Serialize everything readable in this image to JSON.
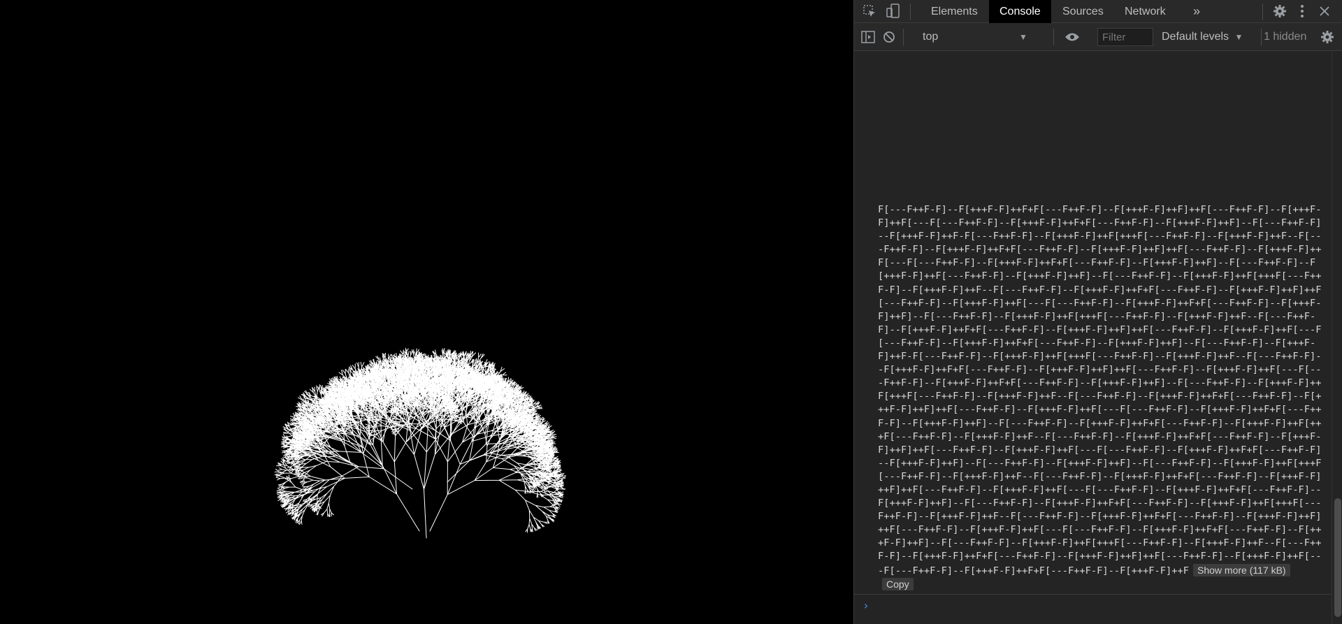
{
  "devtools": {
    "tabs": [
      {
        "label": "Elements",
        "active": false
      },
      {
        "label": "Console",
        "active": true
      },
      {
        "label": "Sources",
        "active": false
      },
      {
        "label": "Network",
        "active": false
      }
    ],
    "more_tabs_glyph": "»",
    "toolbar": {
      "context": "top",
      "filter_placeholder": "Filter",
      "levels": "Default levels",
      "hidden": "1 hidden"
    },
    "log": {
      "text": "F[---F++F-F]--F[+++F-F]++F+F[---F++F-F]--F[+++F-F]++F]++F[---F++F-F]--F[+++F-F]++F[---F[---F++F-F]--F[+++F-F]++F+F[---F++F-F]--F[+++F-F]++F]--F[---F++F-F]--F[+++F-F]++F-F[---F++F-F]--F[+++F-F]++F[+++F[---F++F-F]--F[+++F-F]++F--F[---F++F-F]--F[+++F-F]++F+F[---F++F-F]--F[+++F-F]++F]++F[---F++F-F]--F[+++F-F]++F[---F[---F++F-F]--F[+++F-F]++F+F[---F++F-F]--F[+++F-F]++F]--F[---F++F-F]--F[+++F-F]++F[---F++F-F]--F[+++F-F]++F]--F[---F++F-F]--F[+++F-F]++F[+++F[---F++F-F]--F[+++F-F]++F--F[---F++F-F]--F[+++F-F]++F+F[---F++F-F]--F[+++F-F]++F]++F[---F++F-F]--F[+++F-F]++F[---F[---F++F-F]--F[+++F-F]++F+F[---F++F-F]--F[+++F-F]++F]--F[---F++F-F]--F[+++F-F]++F[+++F[---F++F-F]--F[+++F-F]++F--F[---F++F-F]--F[+++F-F]++F+F[---F++F-F]--F[+++F-F]++F]++F[---F++F-F]--F[+++F-F]++F[---F[---F++F-F]--F[+++F-F]++F+F[---F++F-F]--F[+++F-F]++F]--F[---F++F-F]--F[+++F-F]++F-F[---F++F-F]--F[+++F-F]++F[+++F[---F++F-F]--F[+++F-F]++F--F[---F++F-F]--F[+++F-F]++F+F[---F++F-F]--F[+++F-F]++F]++F[---F++F-F]--F[+++F-F]++F[---F[---F++F-F]--F[+++F-F]++F+F[---F++F-F]--F[+++F-F]++F]--F[---F++F-F]--F[+++F-F]++F[+++F[---F++F-F]--F[+++F-F]++F--F[---F++F-F]--F[+++F-F]++F+F[---F++F-F]--F[+++F-F]++F]++F[---F++F-F]--F[+++F-F]++F[---F[---F++F-F]--F[+++F-F]++F+F[---F++F-F]--F[+++F-F]++F]--F[---F++F-F]--F[+++F-F]++F+F[---F++F-F]--F[+++F-F]++F[+++F[---F++F-F]--F[+++F-F]++F--F[---F++F-F]--F[+++F-F]++F+F[---F++F-F]--F[+++F-F]++F]++F[---F++F-F]--F[+++F-F]++F[---F[---F++F-F]--F[+++F-F]++F+F[---F++F-F]--F[+++F-F]++F]--F[---F++F-F]--F[+++F-F]++F]--F[---F++F-F]--F[+++F-F]++F[+++F[---F++F-F]--F[+++F-F]++F--F[---F++F-F]--F[+++F-F]++F+F[---F++F-F]--F[+++F-F]++F]++F[---F++F-F]--F[+++F-F]++F[---F[---F++F-F]--F[+++F-F]++F+F[---F++F-F]--F[+++F-F]++F]--F[---F++F-F]--F[+++F-F]++F+F[---F++F-F]--F[+++F-F]++F[+++F[---F++F-F]--F[+++F-F]++F--F[---F++F-F]--F[+++F-F]++F+F[---F++F-F]--F[+++F-F]++F]++F[---F++F-F]--F[+++F-F]++F[---F[---F++F-F]--F[+++F-F]++F+F[---F++F-F]--F[+++F-F]++F]--F[---F++F-F]--F[+++F-F]++F[+++F[---F++F-F]--F[+++F-F]++F--F[---F++F-F]--F[+++F-F]++F+F[---F++F-F]--F[+++F-F]++F]++F[---F++F-F]--F[+++F-F]++F[---F[---F++F-F]--F[+++F-F]++F+F[---F++F-F]--F[+++F-F]++F",
      "show_more": "Show more (117 kB)",
      "copy": "Copy"
    },
    "prompt_glyph": "›"
  }
}
